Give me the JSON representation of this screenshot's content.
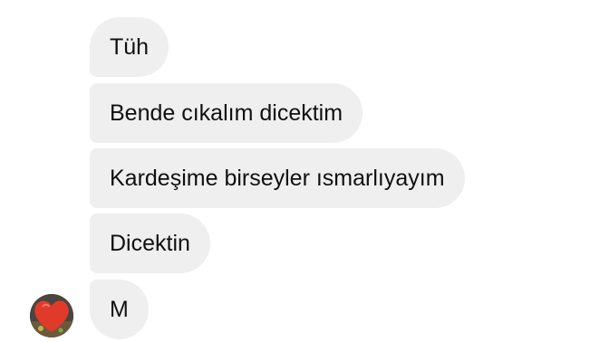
{
  "messages": [
    {
      "text": "Tüh"
    },
    {
      "text": "Bende cıkalım dicektim"
    },
    {
      "text": "Kardeşime birseyler ısmarlıyayım"
    },
    {
      "text": "Dicektin"
    },
    {
      "text": "M"
    }
  ],
  "sender": {
    "avatar_icon": "heart-profile-avatar",
    "colors": {
      "heart": "#e23a2a",
      "bubble_bg": "#efeff0",
      "text": "#101010"
    }
  }
}
